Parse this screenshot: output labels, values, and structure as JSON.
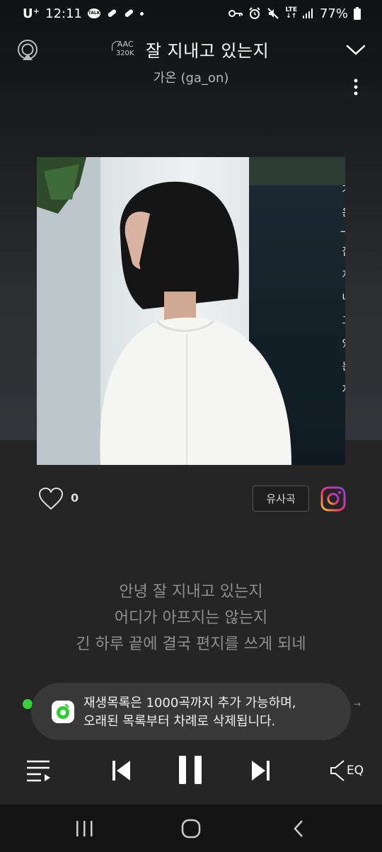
{
  "status_bar": {
    "carrier": "U⁺",
    "time": "12:11",
    "talk_badge": "TALK",
    "lte_top": "LTE",
    "lte_bottom": "↓↑",
    "battery": "77%"
  },
  "header": {
    "quality_codec": "AAC",
    "quality_bitrate": "320K",
    "title": "잘 지내고 있는지",
    "artist": "가온 (ga_on)"
  },
  "album_art": {
    "cover_text": "가 온 | 잘 지 내 고 있 는 지"
  },
  "actions": {
    "like_count": "0",
    "similar_label": "유사곡"
  },
  "lyrics": [
    "안녕 잘 지내고 있는지",
    "어디가 아프지는 않는지",
    "긴 하루 끝에 결국 편지를 쓰게 되네"
  ],
  "toast": {
    "line1": "재생목록은 1000곡까지 추가 가능하며,",
    "line2": "오래된 목록부터 차례로 삭제됩니다."
  },
  "controls": {
    "eq_label": "EQ"
  },
  "colors": {
    "accent_green": "#3ad23a",
    "background": "#252525",
    "lyric_text": "#8f8f8f"
  },
  "icons": [
    "cast-icon",
    "chevron-down-icon",
    "more-vert-icon",
    "heart-icon",
    "instagram-icon",
    "playlist-icon",
    "previous-icon",
    "pause-icon",
    "next-icon",
    "eq-speaker-icon",
    "recent-apps-icon",
    "home-icon",
    "back-icon"
  ]
}
